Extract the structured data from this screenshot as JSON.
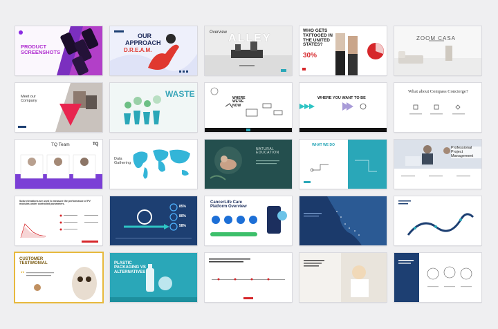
{
  "colors": {
    "purple": "#8a2be2",
    "magenta": "#d5338d",
    "teal": "#2aa7b8",
    "navy": "#1d3f72",
    "red": "#d6262a",
    "darkgreen": "#244f4e",
    "gold": "#e7b93d"
  },
  "slides": [
    {
      "title": "PRODUCT SCREENSHOTS"
    },
    {
      "title_1": "OUR",
      "title_2": "APPROACH",
      "title_3": "D.R.E.A.M."
    },
    {
      "title": "Overview",
      "word": "ALLEY"
    },
    {
      "title": "WHO GETS TATTOOED IN THE UNITED STATES?",
      "stat": "30%"
    },
    {
      "title": "ZOOM CASA"
    },
    {
      "title": "Meet our Company"
    },
    {
      "title": "WASTE"
    },
    {
      "title": "WHERE WE'RE NOW"
    },
    {
      "title": "WHERE YOU WANT TO BE"
    },
    {
      "title": "What about Compass Concierge?"
    },
    {
      "title": "TQ Team",
      "logo": "TQ"
    },
    {
      "title": "Data Gathering"
    },
    {
      "title": "NATURAL EDUCATION"
    },
    {
      "title": "WHAT WE DO"
    },
    {
      "title": "Professional Project Management"
    },
    {
      "title": "Solar elevations are used to measure the performance of PV modules under controlled parameters."
    },
    {
      "stat_1": "85%",
      "stat_2": "80%",
      "stat_3": "58%"
    },
    {
      "title": "CancerLife Care Platform Overview"
    },
    {
      "title": ""
    },
    {
      "title": ""
    },
    {
      "title": "CUSTOMER TESTIMONIAL"
    },
    {
      "title": "PLASTIC PACKAGING VS ALTERNATIVES"
    },
    {
      "title": ""
    },
    {
      "title": ""
    },
    {
      "title": ""
    }
  ]
}
